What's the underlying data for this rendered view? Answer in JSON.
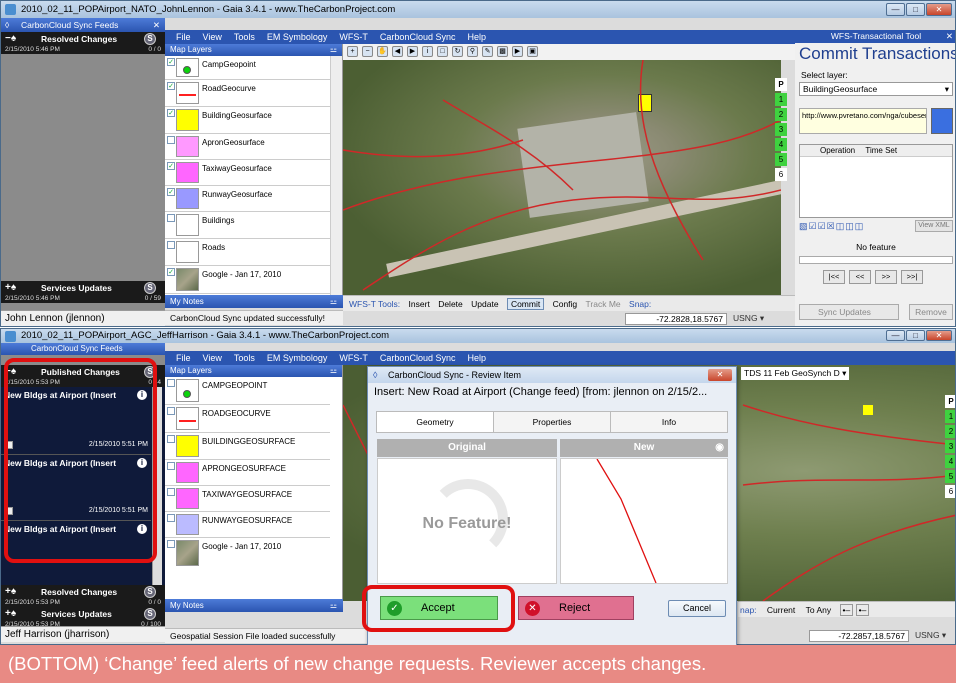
{
  "top": {
    "title": "2010_02_11_POPAirport_NATO_JohnLennon - Gaia 3.4.1 - www.TheCarbonProject.com",
    "feeds_title": "CarbonCloud Sync Feeds",
    "resolved_label": "Resolved Changes",
    "resolved_time": "2/15/2010 5:46 PM",
    "resolved_count": "0 / 0",
    "services_label": "Services Updates",
    "services_time": "2/15/2010 5:46 PM",
    "services_count": "0 / 59",
    "user": "John Lennon (jlennon)",
    "menu": [
      "File",
      "View",
      "Tools",
      "EM Symbology",
      "WFS-T",
      "CarbonCloud Sync",
      "Help"
    ],
    "map_layers_label": "Map Layers",
    "layers": [
      "CampGeopoint",
      "RoadGeocurve",
      "BuildingGeosurface",
      "ApronGeosurface",
      "TaxiwayGeosurface",
      "RunwayGeosurface",
      "Buildings",
      "Roads",
      "Google - Jan 17, 2010"
    ],
    "my_notes": "My Notes",
    "status": "CarbonCloud Sync updated successfully!",
    "wfs_tools": "WFS-T Tools:",
    "wfs_buttons": [
      "Insert",
      "Delete",
      "Update",
      "Commit",
      "Config",
      "Track Me",
      "Snap:"
    ],
    "coords": "-72.2828,18.5767",
    "usng": "USNG",
    "numbers": [
      "P",
      "1",
      "2",
      "3",
      "4",
      "5",
      "6"
    ]
  },
  "wfs_panel": {
    "title": "WFS-Transactional Tool",
    "heading": "Commit Transactions",
    "select_layer_label": "Select layer:",
    "selected_layer": "BuildingGeosurface",
    "url": "http://www.pvretano.com/nga/cubeserv.cgi?",
    "col_operation": "Operation",
    "col_time": "Time Set",
    "view_xml": "View XML",
    "no_feature": "No feature",
    "nav": [
      "|<<",
      "<<",
      ">>",
      ">>|"
    ],
    "sync_updates": "Sync Updates",
    "remove": "Remove"
  },
  "bottom": {
    "title": "2010_02_11_POPAirport_AGC_JeffHarrison - Gaia 3.4.1 - www.TheCarbonProject.com",
    "feeds_title": "CarbonCloud Sync Feeds",
    "published_label": "Published Changes",
    "published_time": "2/15/2010 5:53 PM",
    "published_count": "0 / 4",
    "items": [
      {
        "title": "New Bldgs at Airport (Insert",
        "time": "2/15/2010 5:51 PM"
      },
      {
        "title": "New Bldgs at Airport (Insert",
        "time": "2/15/2010 5:51 PM"
      },
      {
        "title": "New Bldgs at Airport (Insert",
        "time": ""
      }
    ],
    "resolved_label": "Resolved Changes",
    "resolved_time": "2/15/2010 5:53 PM",
    "resolved_count": "0 / 0",
    "services_label": "Services Updates",
    "services_time": "2/15/2010 5:53 PM",
    "services_count": "0 / 100",
    "user": "Jeff Harrison (jharrison)",
    "menu": [
      "File",
      "View",
      "Tools",
      "EM Symbology",
      "WFS-T",
      "CarbonCloud Sync",
      "Help"
    ],
    "map_layers_label": "Map Layers",
    "layers": [
      "CAMPGEOPOINT",
      "ROADGEOCURVE",
      "BUILDINGGEOSURFACE",
      "APRONGEOSURFACE",
      "TAXIWAYGEOSURFACE",
      "RUNWAYGEOSURFACE",
      "Google - Jan 17, 2010"
    ],
    "my_notes": "My Notes",
    "status": "Geospatial Session File loaded successfully",
    "layer_select": "TDS 11 Feb GeoSynch D",
    "snap_bar": [
      "nap:",
      "Current",
      "To Any"
    ],
    "coords": "-72.2857,18.5767",
    "usng": "USNG",
    "numbers": [
      "P",
      "1",
      "2",
      "3",
      "4",
      "5",
      "6"
    ]
  },
  "dialog": {
    "title": "CarbonCloud Sync - Review Item",
    "subtitle": "Insert: New Road at Airport (Change feed) [from: jlennon on 2/15/2...",
    "tabs": [
      "Geometry",
      "Properties",
      "Info"
    ],
    "original_label": "Original",
    "new_label": "New",
    "no_feature": "No Feature!",
    "accept": "Accept",
    "reject": "Reject",
    "cancel": "Cancel"
  },
  "caption": "(BOTTOM) ‘Change’ feed alerts of new change requests.  Reviewer accepts changes.",
  "colors": {
    "swatches": [
      "#0cd40c",
      "#ff2020",
      "#ffff00",
      "#ff99ff",
      "#ff66ff",
      "#9999ff",
      "#ffffff",
      "#ffffff",
      "#888888"
    ],
    "highlight": "#e01010",
    "accept": "#7be07b",
    "reject": "#e07090",
    "caption_bg": "#e88a84"
  }
}
